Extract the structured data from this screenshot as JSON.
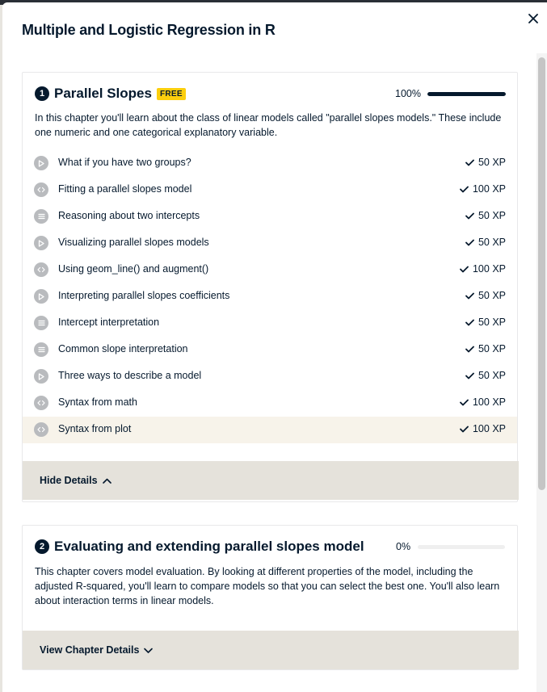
{
  "modal": {
    "title": "Multiple and Logistic Regression in R",
    "close_icon": "close-icon"
  },
  "chapters": [
    {
      "number": "1",
      "title": "Parallel Slopes",
      "badge": "FREE",
      "progress_label": "100%",
      "progress": 1.0,
      "description": "In this chapter you'll learn about the class of linear models called \"parallel slopes models.\" These include one numeric and one categorical explanatory variable.",
      "exercises": [
        {
          "name": "What if you have two groups?",
          "xp": "50 XP",
          "type": "video"
        },
        {
          "name": "Fitting a parallel slopes model",
          "xp": "100 XP",
          "type": "code"
        },
        {
          "name": "Reasoning about two intercepts",
          "xp": "50 XP",
          "type": "mcq"
        },
        {
          "name": "Visualizing parallel slopes models",
          "xp": "50 XP",
          "type": "video"
        },
        {
          "name": "Using geom_line() and augment()",
          "xp": "100 XP",
          "type": "code"
        },
        {
          "name": "Interpreting parallel slopes coefficients",
          "xp": "50 XP",
          "type": "video"
        },
        {
          "name": "Intercept interpretation",
          "xp": "50 XP",
          "type": "mcq"
        },
        {
          "name": "Common slope interpretation",
          "xp": "50 XP",
          "type": "mcq"
        },
        {
          "name": "Three ways to describe a model",
          "xp": "50 XP",
          "type": "video"
        },
        {
          "name": "Syntax from math",
          "xp": "100 XP",
          "type": "code"
        },
        {
          "name": "Syntax from plot",
          "xp": "100 XP",
          "type": "code"
        }
      ],
      "details_label": "Hide Details"
    },
    {
      "number": "2",
      "title": "Evaluating and extending parallel slopes model",
      "progress_label": "0%",
      "progress": 0.0,
      "description": "This chapter covers model evaluation. By looking at different properties of the model, including the adjusted R-squared, you'll learn to compare models so that you can select the best one. You'll also learn about interaction terms in linear models.",
      "details_label": "View Chapter Details"
    }
  ]
}
